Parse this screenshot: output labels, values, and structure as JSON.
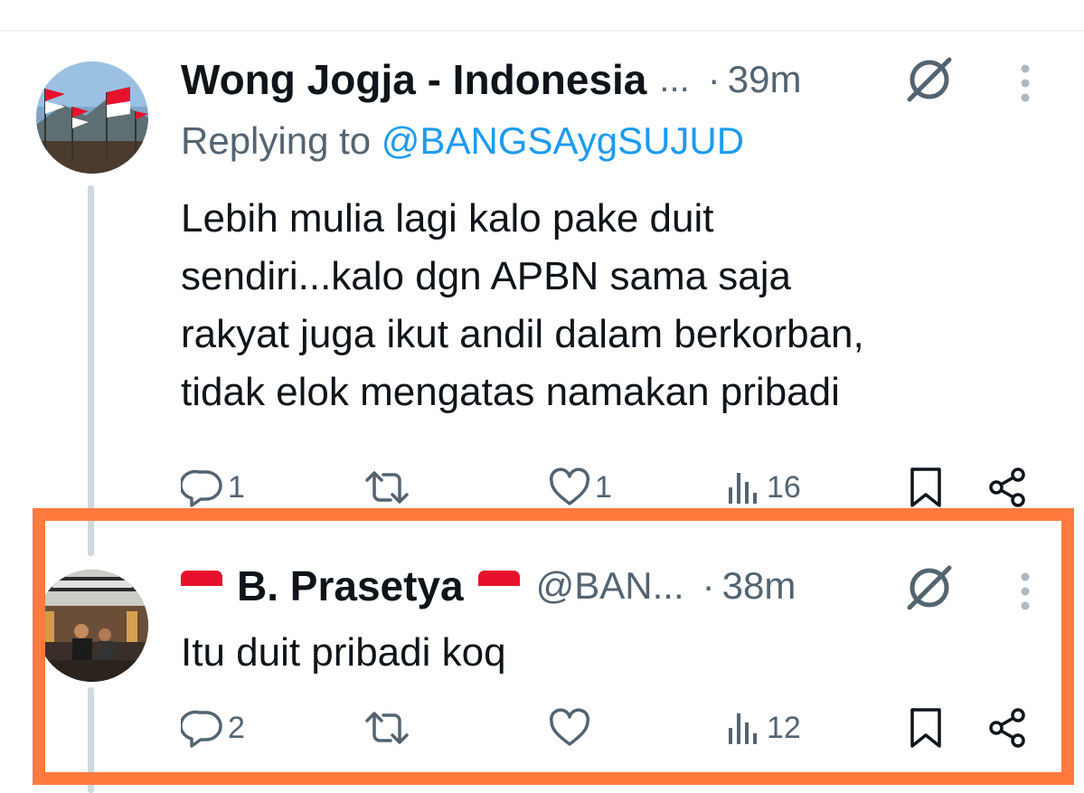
{
  "tweets": [
    {
      "display_name": "Wong Jogja - Indonesia",
      "name_ellipsis": "...",
      "separator": "·",
      "time": "39m",
      "reply_prefix": "Replying to",
      "reply_mention": "@BANGSAygSUJUD",
      "text_lines": [
        "Lebih mulia lagi kalo pake duit",
        "sendiri...kalo dgn APBN sama saja",
        "rakyat juga ikut andil dalam berkorban,",
        "tidak elok mengatas namakan pribadi"
      ],
      "reply_count": "1",
      "retweet_count": "",
      "like_count": "1",
      "view_count": "16"
    },
    {
      "display_name": "B. Prasetya",
      "handle": "@BAN...",
      "separator": "·",
      "time": "38m",
      "text": "Itu duit pribadi koq",
      "reply_count": "2",
      "retweet_count": "",
      "like_count": "",
      "view_count": "12"
    }
  ],
  "colors": {
    "highlight_border": "#ff7a3c",
    "mention": "#1d9bf0",
    "secondary_text": "#536471",
    "thread_line": "#cfd9de",
    "flag_red": "#e8112d"
  },
  "icons": [
    "reply-icon",
    "retweet-icon",
    "like-icon",
    "views-icon",
    "bookmark-icon",
    "share-icon",
    "grok-icon",
    "more-icon",
    "indonesia-flag-icon"
  ]
}
